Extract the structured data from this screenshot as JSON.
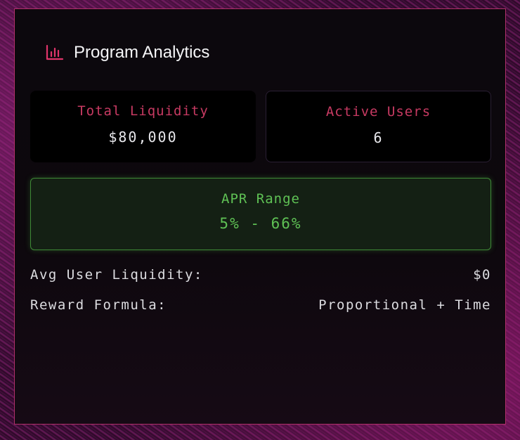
{
  "header": {
    "icon": "bar-chart-icon",
    "title": "Program Analytics"
  },
  "stats": {
    "total_liquidity": {
      "label": "Total Liquidity",
      "value": "$80,000"
    },
    "active_users": {
      "label": "Active Users",
      "value": "6"
    }
  },
  "apr": {
    "label": "APR Range",
    "value": "5% - 66%"
  },
  "details": [
    {
      "label": "Avg User Liquidity:",
      "value": "$0"
    },
    {
      "label": "Reward Formula:",
      "value": "Proportional + Time"
    }
  ],
  "colors": {
    "accent_pink": "#c73a62",
    "accent_green": "#5fc255",
    "panel_border": "#b0306a"
  }
}
